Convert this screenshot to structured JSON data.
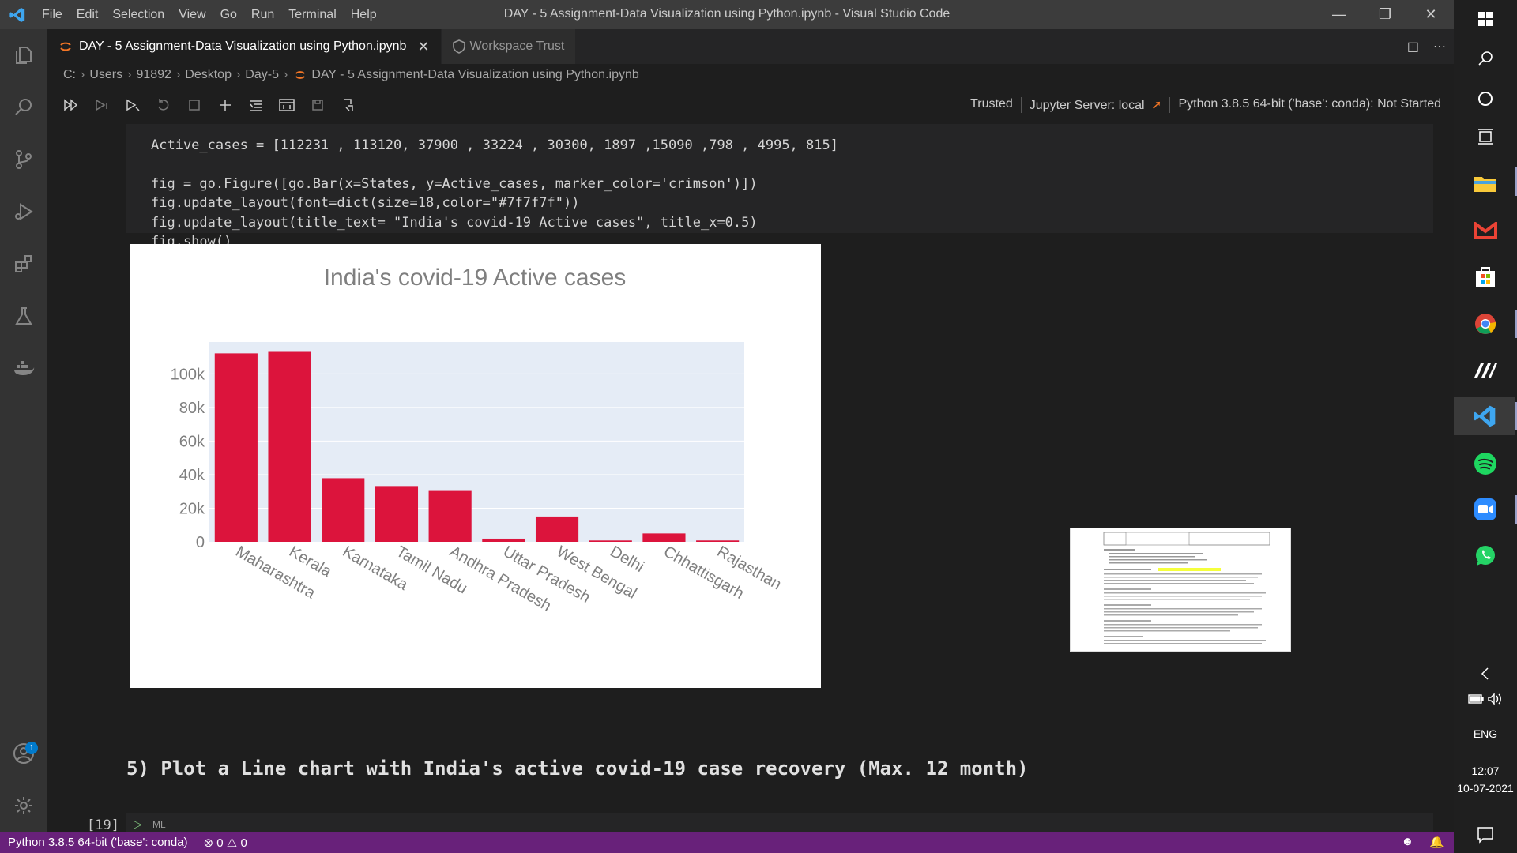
{
  "window": {
    "title": "DAY - 5 Assignment-Data Visualization using Python.ipynb - Visual Studio Code",
    "menu": [
      "File",
      "Edit",
      "Selection",
      "View",
      "Go",
      "Run",
      "Terminal",
      "Help"
    ]
  },
  "tabs": [
    {
      "label": "DAY - 5 Assignment-Data Visualization using Python.ipynb",
      "active": true
    },
    {
      "label": "Workspace Trust",
      "active": false
    }
  ],
  "breadcrumb": [
    "C:",
    "Users",
    "91892",
    "Desktop",
    "Day-5",
    "DAY - 5 Assignment-Data Visualization using Python.ipynb"
  ],
  "notebook_toolbar": {
    "trusted": "Trusted",
    "server": "Jupyter Server: local",
    "kernel": "Python 3.8.5 64-bit ('base': conda): Not Started"
  },
  "code": {
    "line0": "Active_cases = [112231 , 113120, 37900 , 33224 , 30300, 1897 ,15090 ,798 , 4995, 815]",
    "line1": "",
    "line2": "fig = go.Figure([go.Bar(x=States, y=Active_cases, marker_color='crimson')])",
    "line3": "fig.update_layout(font=dict(size=18,color=\"#7f7f7f\"))",
    "line4": "fig.update_layout(title_text= \"India's covid-19 Active cases\", title_x=0.5)",
    "line5": "fig.show()"
  },
  "chart_data": {
    "type": "bar",
    "title": "India's covid-19 Active cases",
    "categories": [
      "Maharashtra",
      "Kerala",
      "Karnataka",
      "Tamil Nadu",
      "Andhra Pradesh",
      "Uttar Pradesh",
      "West Bengal",
      "Delhi",
      "Chhattisgarh",
      "Rajasthan"
    ],
    "values": [
      112231,
      113120,
      37900,
      33224,
      30300,
      1897,
      15090,
      798,
      4995,
      815
    ],
    "yticks": [
      "0",
      "20k",
      "40k",
      "60k",
      "80k",
      "100k"
    ],
    "ytick_values": [
      0,
      20000,
      40000,
      60000,
      80000,
      100000
    ],
    "ylim": [
      0,
      119000
    ],
    "bar_color": "#dc143c",
    "plot_bg": "#e5ecf6",
    "font_color": "#7f7f7f",
    "grid": true
  },
  "markdown": {
    "heading": "5) Plot a Line chart with India's active covid-19 case recovery (Max. 12 month)"
  },
  "next_cell": {
    "count": "[19]",
    "lang": "ML"
  },
  "statusbar": {
    "interpreter": "Python 3.8.5 64-bit ('base': conda)",
    "errors": "0",
    "warnings": "0"
  },
  "taskbar": {
    "lang": "ENG",
    "time": "12:07",
    "date": "10-07-2021"
  },
  "colors": {
    "accent": "#007acc",
    "statusbar": "#68217a"
  }
}
